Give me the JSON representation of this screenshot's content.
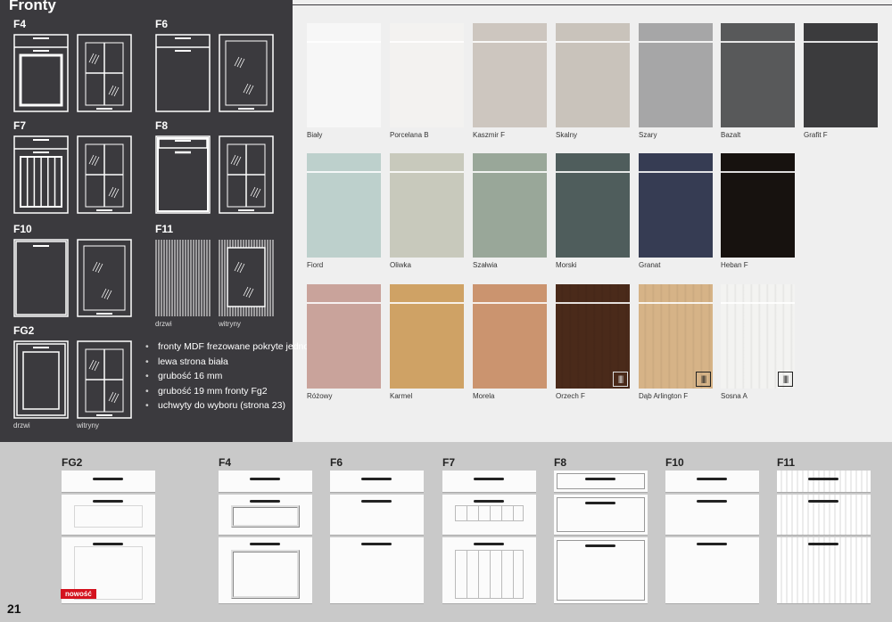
{
  "title": "Fronty",
  "fronts": [
    {
      "code": "F4",
      "door": "f4",
      "vitrine": "grid"
    },
    {
      "code": "F6",
      "door": "plain",
      "vitrine": "glass"
    },
    {
      "code": "F7",
      "door": "f7",
      "vitrine": "grid"
    },
    {
      "code": "F8",
      "door": "f8",
      "vitrine": "grid"
    },
    {
      "code": "F10",
      "door": "plain10",
      "vitrine": "glass"
    },
    {
      "code": "F11",
      "door": "ribbed",
      "vitrine": "ribglass"
    },
    {
      "code": "FG2",
      "door": "fg2",
      "vitrine": "grid"
    }
  ],
  "caption_door": "drzwi",
  "caption_vitrine": "witryny",
  "features": [
    "fronty MDF frezowane pokryte jednostronnie folią",
    "lewa strona biała",
    "grubość 16 mm",
    "grubość 19 mm fronty Fg2",
    "uchwyty do wyboru (strona 23)"
  ],
  "swatches": [
    {
      "name": "Biały",
      "color": "#f7f7f7"
    },
    {
      "name": "Porcelana B",
      "color": "#f3f2f0"
    },
    {
      "name": "Kaszmir F",
      "color": "#cdc6bf"
    },
    {
      "name": "Skalny",
      "color": "#c9c3bb"
    },
    {
      "name": "Szary",
      "color": "#a6a6a7"
    },
    {
      "name": "Bazalt",
      "color": "#58595a"
    },
    {
      "name": "Grafit F",
      "color": "#3b3b3d"
    },
    {
      "name": "Fiord",
      "color": "#bdd0cc"
    },
    {
      "name": "Oliwka",
      "color": "#c8c9bc"
    },
    {
      "name": "Szałwia",
      "color": "#99a799"
    },
    {
      "name": "Morski",
      "color": "#4f5d5c"
    },
    {
      "name": "Granat",
      "color": "#363c53"
    },
    {
      "name": "Heban F",
      "color": "#17120f"
    },
    {
      "name": "Różowy",
      "color": "#c9a39b"
    },
    {
      "name": "Karmel",
      "color": "#cfa265"
    },
    {
      "name": "Morela",
      "color": "#cb946f"
    },
    {
      "name": "Orzech F",
      "color": "#4a2a1a",
      "grain": "||||"
    },
    {
      "name": "Dąb Arlington F",
      "color": "#d6b387",
      "grain": "||||"
    },
    {
      "name": "Sosna A",
      "color": "#f3f3f1",
      "grain": "||||"
    }
  ],
  "cabinets": [
    "FG2",
    "F4",
    "F6",
    "F7",
    "F8",
    "F10",
    "F11"
  ],
  "badge": "nowość",
  "page_number": "21"
}
